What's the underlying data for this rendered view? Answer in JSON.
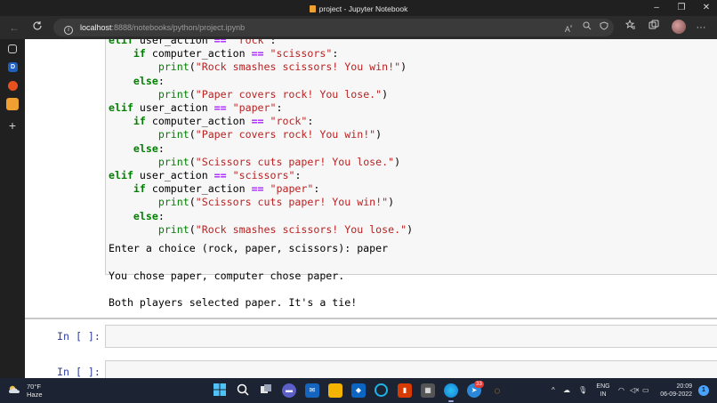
{
  "window": {
    "title": "project - Jupyter Notebook",
    "controls": {
      "minimize": "–",
      "maximize": "❐",
      "close": "✕"
    }
  },
  "browser": {
    "url_host": "localhost",
    "url_path": ":8888/notebooks/python/project.ipynb",
    "back_icon": "←",
    "refresh_icon": "C",
    "toolbar_icons": [
      "read-aloud-icon",
      "zoom-icon",
      "tracking-icon",
      "favorites-icon",
      "collections-icon",
      "profile-avatar",
      "more-icon"
    ],
    "read_aloud": "A⁩ᵃ",
    "more": "···"
  },
  "sidebar": {
    "items": [
      {
        "name": "tabs-icon",
        "glyph": "▣"
      },
      {
        "name": "d-icon",
        "glyph": "D"
      },
      {
        "name": "orange-circle-icon",
        "glyph": "◡"
      },
      {
        "name": "jupyter-icon",
        "glyph": "▥"
      },
      {
        "name": "add-icon",
        "glyph": "+"
      }
    ]
  },
  "notebook": {
    "code_lines": [
      "elif user_action == \"rock\":",
      "    if computer_action == \"scissors\":",
      "        print(\"Rock smashes scissors! You win!\")",
      "    else:",
      "        print(\"Paper covers rock! You lose.\")",
      "elif user_action == \"paper\":",
      "    if computer_action == \"rock\":",
      "        print(\"Paper covers rock! You win!\")",
      "    else:",
      "        print(\"Scissors cuts paper! You lose.\")",
      "elif user_action == \"scissors\":",
      "    if computer_action == \"paper\":",
      "        print(\"Scissors cuts paper! You win!\")",
      "    else:",
      "        print(\"Rock smashes scissors! You lose.\")"
    ],
    "output_lines": [
      "Enter a choice (rock, paper, scissors): paper",
      "You chose paper, computer chose paper.",
      "Both players selected paper. It's a tie!"
    ],
    "prompt_1": "In [ ]:",
    "prompt_2": "In [ ]:"
  },
  "taskbar": {
    "weather_temp": "70°F",
    "weather_desc": "Haze",
    "language_1": "ENG",
    "language_2": "IN",
    "time": "20:09",
    "date": "06-09-2022",
    "notifications": "1",
    "teams_badge": "33"
  },
  "colors": {
    "keyword": "#008000",
    "operator": "#aa22ff",
    "string": "#ba2121",
    "prompt": "#303f9f"
  }
}
